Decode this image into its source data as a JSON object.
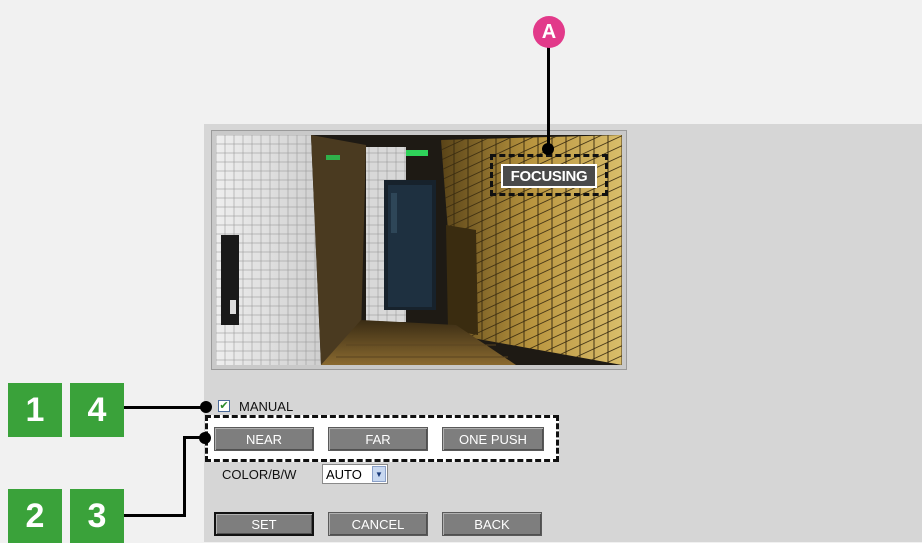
{
  "preview": {
    "overlay_text": "FOCUSING"
  },
  "callouts": {
    "a": "A",
    "badge_1": "1",
    "badge_4": "4",
    "badge_2": "2",
    "badge_3": "3"
  },
  "focus": {
    "manual_label": "MANUAL",
    "manual_checked": true,
    "near_label": "NEAR",
    "far_label": "FAR",
    "one_push_label": "ONE PUSH"
  },
  "color_mode": {
    "label": "COLOR/B/W",
    "value": "AUTO"
  },
  "footer": {
    "set_label": "SET",
    "cancel_label": "CANCEL",
    "back_label": "BACK"
  },
  "colors": {
    "panel_bg": "#d6d6d6",
    "button_bg": "#7e7e7e",
    "callout_pink": "#e23a8a",
    "badge_green": "#3aa23a"
  }
}
